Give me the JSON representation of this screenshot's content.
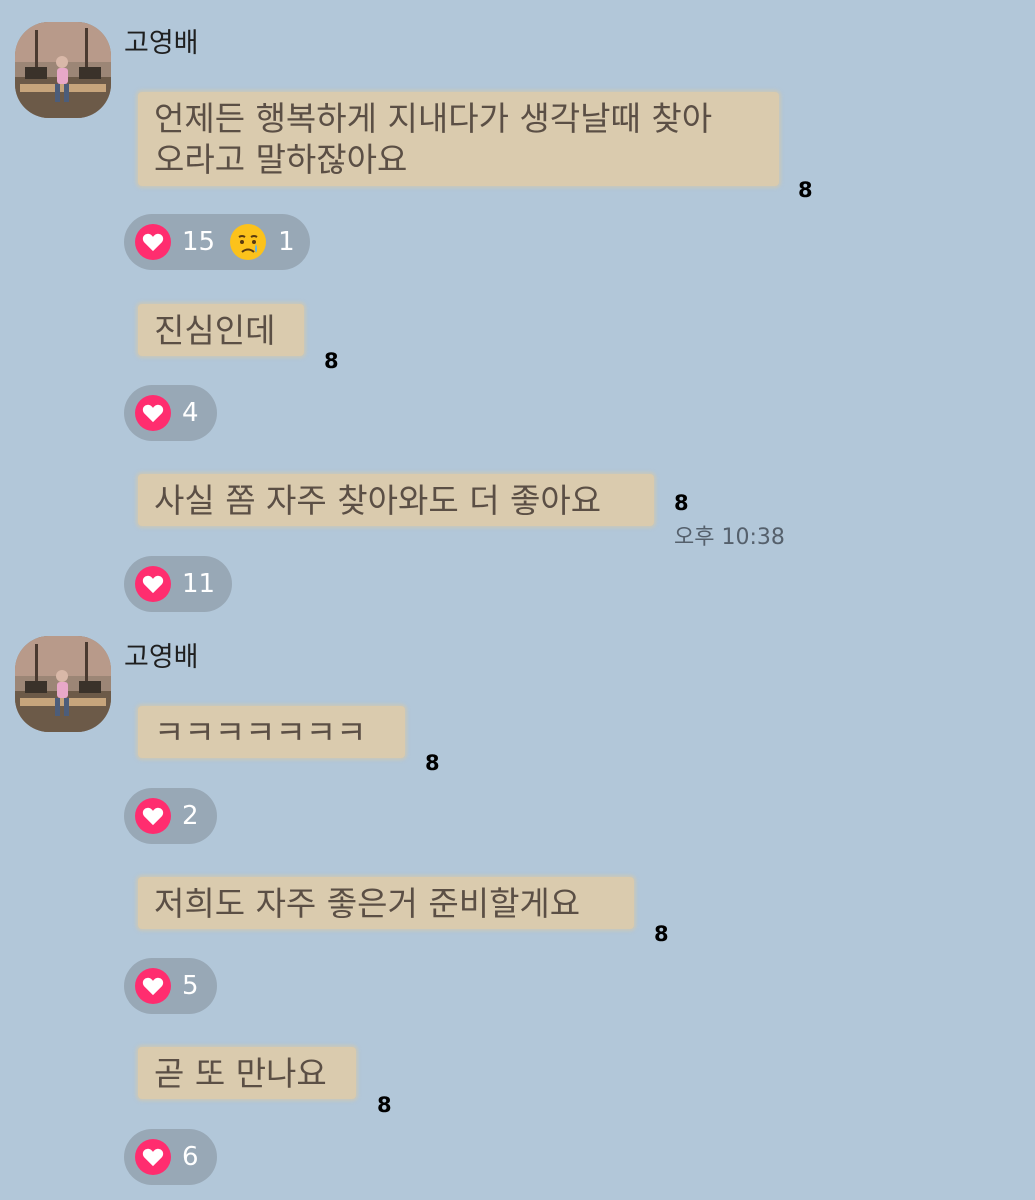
{
  "colors": {
    "background": "#b2c7d9",
    "bubble": "#dacbae",
    "bubble_text": "#5b4f45",
    "reaction_pill": "#98a8b6",
    "heart": "#ff2d6f"
  },
  "groups": [
    {
      "sender": "고영배",
      "messages": [
        {
          "text": "언제든 행복하게 지내다가 생각날때 찾아\n오라고 말하잖아요",
          "unread": "8",
          "reactions": [
            {
              "icon": "heart-icon",
              "count": "15"
            },
            {
              "icon": "crying-face-icon",
              "count": "1"
            }
          ]
        },
        {
          "text": "진심인데",
          "unread": "8",
          "reactions": [
            {
              "icon": "heart-icon",
              "count": "4"
            }
          ]
        },
        {
          "text": "사실 쫌 자주 찾아와도 더 좋아요",
          "unread": "8",
          "time": "오후 10:38",
          "reactions": [
            {
              "icon": "heart-icon",
              "count": "11"
            }
          ]
        }
      ]
    },
    {
      "sender": "고영배",
      "messages": [
        {
          "text": "ㅋㅋㅋㅋㅋㅋㅋ",
          "unread": "8",
          "reactions": [
            {
              "icon": "heart-icon",
              "count": "2"
            }
          ]
        },
        {
          "text": "저희도 자주 좋은거 준비할게요",
          "unread": "8",
          "reactions": [
            {
              "icon": "heart-icon",
              "count": "5"
            }
          ]
        },
        {
          "text": "곧 또 만나요",
          "unread": "8",
          "reactions": [
            {
              "icon": "heart-icon",
              "count": "6"
            }
          ]
        }
      ]
    }
  ]
}
